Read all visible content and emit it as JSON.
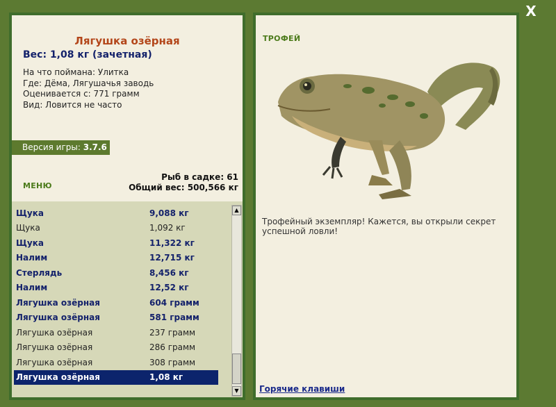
{
  "window": {
    "close_label": "X"
  },
  "fish": {
    "title": "Лягушка озёрная",
    "weight_line": "Вес: 1,08 кг (зачетная)",
    "caught_on": "На что поймана: Улитка",
    "where": "Где: Дёма, Лягушачья заводь",
    "valued_from": "Оценивается с: 771 грамм",
    "kind": "Вид: Ловится не часто"
  },
  "version": {
    "label": "Версия игры:",
    "value": "3.7.6"
  },
  "menu": {
    "label": "МЕНЮ"
  },
  "stats": {
    "fish_count": "Рыб в садке: 61",
    "total_weight": "Общий вес: 500,566 кг"
  },
  "catch_list": [
    {
      "name": "Щука",
      "weight": "9,088 кг",
      "style": "bold"
    },
    {
      "name": "Щука",
      "weight": "1,092 кг",
      "style": "normal"
    },
    {
      "name": "Щука",
      "weight": "11,322 кг",
      "style": "bold"
    },
    {
      "name": "Налим",
      "weight": "12,715 кг",
      "style": "bold"
    },
    {
      "name": "Стерлядь",
      "weight": "8,456 кг",
      "style": "bold"
    },
    {
      "name": "Налим",
      "weight": "12,52 кг",
      "style": "bold"
    },
    {
      "name": "Лягушка озёрная",
      "weight": "604 грамм",
      "style": "bold"
    },
    {
      "name": "Лягушка озёрная",
      "weight": "581 грамм",
      "style": "bold"
    },
    {
      "name": "Лягушка озёрная",
      "weight": "237 грамм",
      "style": "normal"
    },
    {
      "name": "Лягушка озёрная",
      "weight": "286 грамм",
      "style": "normal"
    },
    {
      "name": "Лягушка озёрная",
      "weight": "308 грамм",
      "style": "normal"
    },
    {
      "name": "Лягушка озёрная",
      "weight": "1,08 кг",
      "style": "selected"
    }
  ],
  "trophy": {
    "label": "ТРОФЕЙ",
    "text": "Трофейный экземпляр! Кажется, вы открыли секрет успешной ловли!"
  },
  "hotkeys": {
    "label": "Горячие клавиши"
  },
  "colors": {
    "frame_green": "#5c7a32",
    "panel_bg": "#f3efe0",
    "title_orange": "#b3461a",
    "bold_blue": "#14226b",
    "selected_bg": "#0c246c",
    "list_bg": "#d6d8b8"
  }
}
